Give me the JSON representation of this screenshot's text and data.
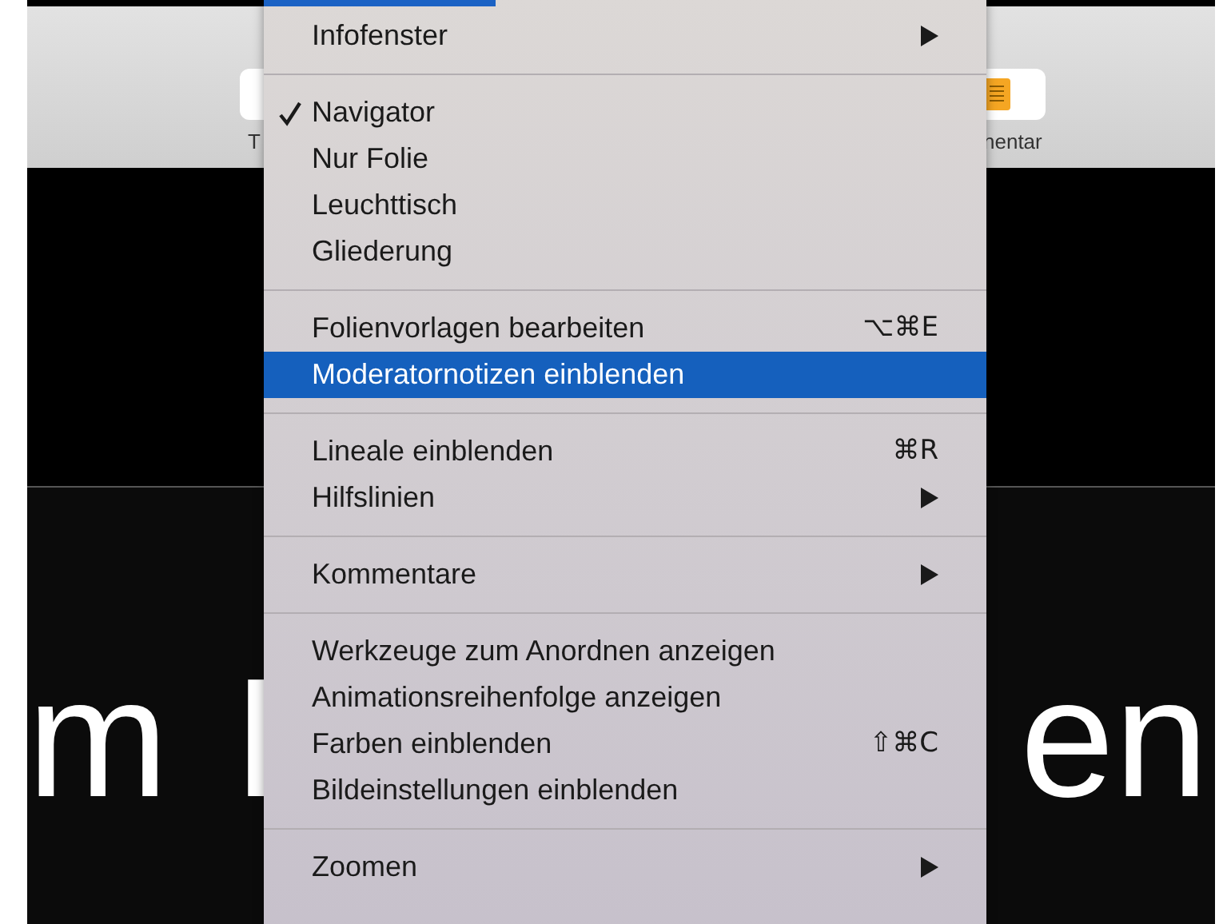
{
  "toolbar": {
    "left_item": {
      "label": "T"
    },
    "right_item": {
      "label": "nentar"
    }
  },
  "slide": {
    "texts": [
      "m",
      "I",
      "en"
    ]
  },
  "menu": {
    "groups": [
      {
        "items": [
          {
            "label": "Infofenster",
            "submenu": true,
            "checked": false,
            "selected": false
          }
        ]
      },
      {
        "items": [
          {
            "label": "Navigator",
            "submenu": false,
            "checked": true,
            "selected": false
          },
          {
            "label": "Nur Folie",
            "submenu": false,
            "checked": false,
            "selected": false
          },
          {
            "label": "Leuchttisch",
            "submenu": false,
            "checked": false,
            "selected": false
          },
          {
            "label": "Gliederung",
            "submenu": false,
            "checked": false,
            "selected": false
          }
        ]
      },
      {
        "items": [
          {
            "label": "Folienvorlagen bearbeiten",
            "shortcut": "⌥⌘E",
            "submenu": false,
            "checked": false,
            "selected": false
          },
          {
            "label": "Moderatornotizen einblenden",
            "submenu": false,
            "checked": false,
            "selected": true
          }
        ]
      },
      {
        "items": [
          {
            "label": "Lineale einblenden",
            "shortcut": "⌘R",
            "submenu": false,
            "checked": false,
            "selected": false
          },
          {
            "label": "Hilfslinien",
            "submenu": true,
            "checked": false,
            "selected": false
          }
        ]
      },
      {
        "items": [
          {
            "label": "Kommentare",
            "submenu": true,
            "checked": false,
            "selected": false
          }
        ]
      },
      {
        "items": [
          {
            "label": "Werkzeuge zum Anordnen anzeigen",
            "submenu": false,
            "checked": false,
            "selected": false
          },
          {
            "label": "Animationsreihenfolge anzeigen",
            "submenu": false,
            "checked": false,
            "selected": false
          },
          {
            "label": "Farben einblenden",
            "shortcut": "⇧⌘C",
            "submenu": false,
            "checked": false,
            "selected": false
          },
          {
            "label": "Bildeinstellungen einblenden",
            "submenu": false,
            "checked": false,
            "selected": false
          }
        ]
      },
      {
        "items": [
          {
            "label": "Zoomen",
            "submenu": true,
            "checked": false,
            "selected": false
          }
        ]
      }
    ]
  }
}
